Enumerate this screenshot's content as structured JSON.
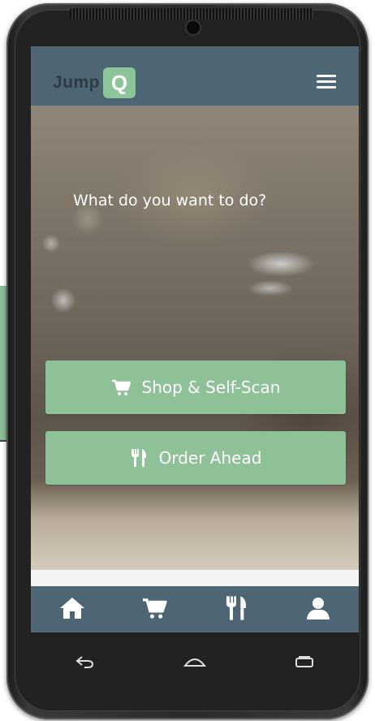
{
  "header": {
    "logo_text": "Jump",
    "logo_badge": "Q",
    "menu_icon": "hamburger-menu-icon"
  },
  "main": {
    "prompt": "What do you want to do?",
    "actions": [
      {
        "label": "Shop & Self-Scan",
        "icon": "shopping-cart-icon"
      },
      {
        "label": "Order Ahead",
        "icon": "fork-knife-icon"
      }
    ]
  },
  "tabbar": {
    "tabs": [
      {
        "icon": "home-icon"
      },
      {
        "icon": "shopping-cart-icon"
      },
      {
        "icon": "fork-knife-icon"
      },
      {
        "icon": "user-icon"
      }
    ]
  },
  "system_nav": {
    "buttons": [
      "back-icon",
      "home-icon",
      "recent-apps-icon"
    ]
  },
  "colors": {
    "header_bg": "#4e6573",
    "accent_green": "#8ec197",
    "logo_badge": "#8cc59a"
  }
}
